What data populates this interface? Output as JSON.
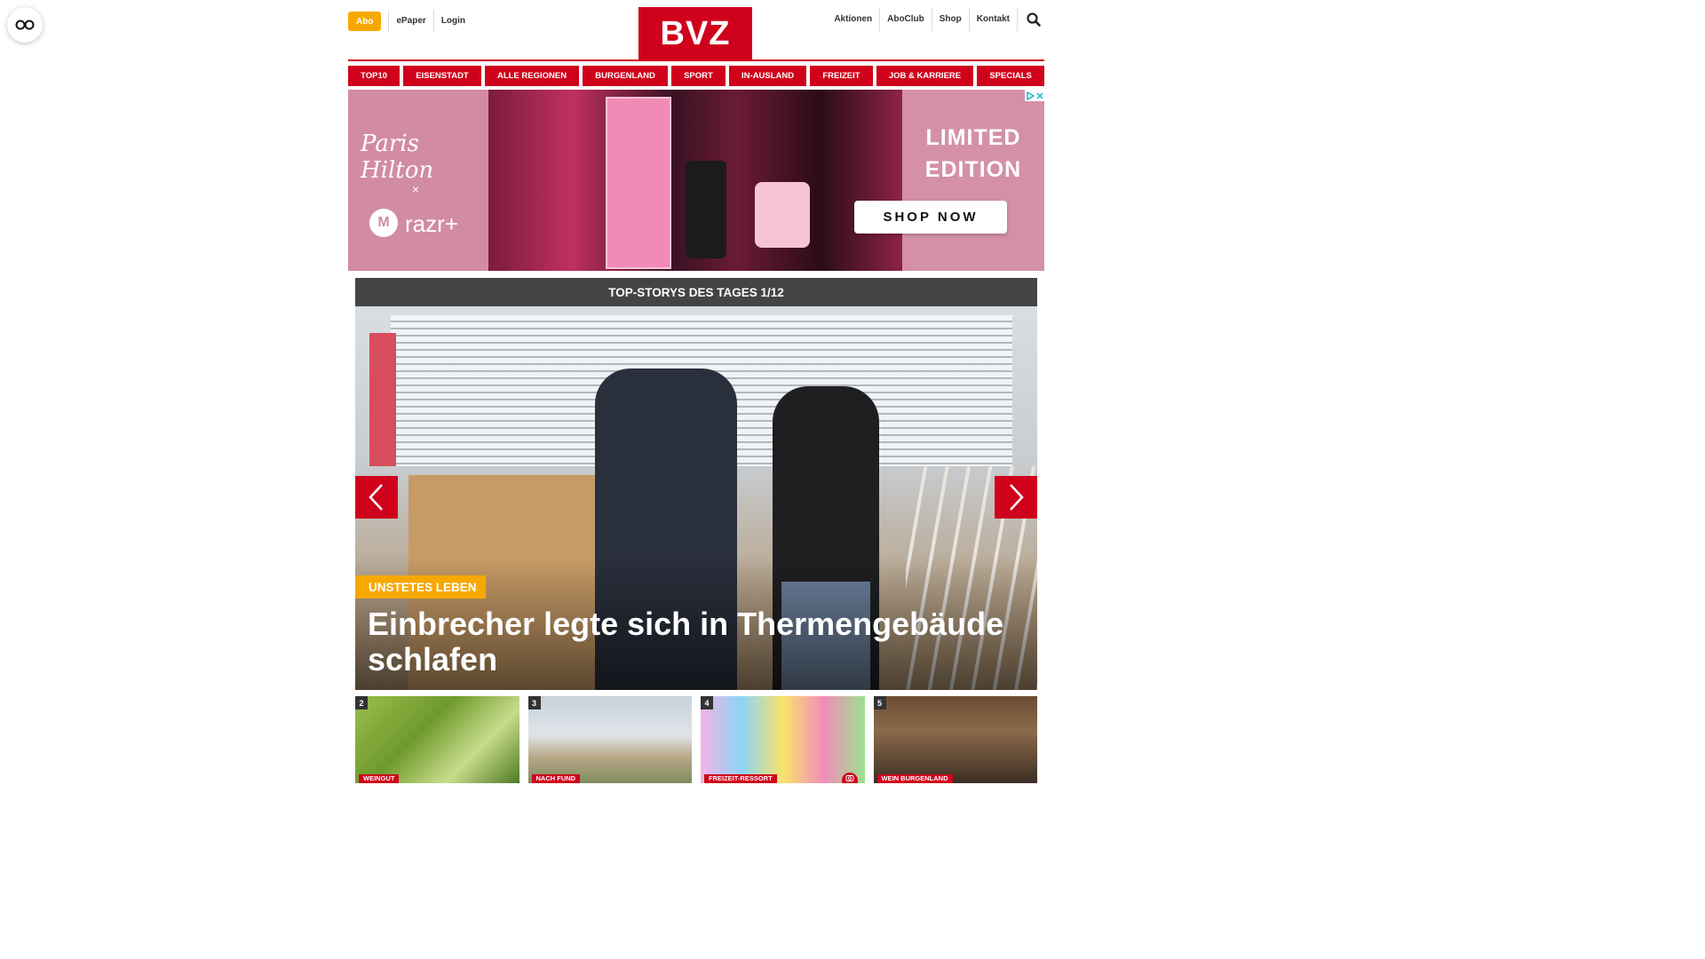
{
  "header": {
    "abo": "Abo",
    "epaper": "ePaper",
    "login": "Login",
    "logo": "BVZ",
    "right_links": [
      "Aktionen",
      "AboClub",
      "Shop",
      "Kontakt"
    ]
  },
  "nav": {
    "items": [
      "TOP10",
      "EISENSTADT",
      "ALLE REGIONEN",
      "BURGENLAND",
      "SPORT",
      "IN-AUSLAND",
      "FREIZEIT",
      "JOB & KARRIERE",
      "SPECIALS"
    ]
  },
  "ad": {
    "brand_script": "Paris Hilton",
    "x": "×",
    "moto_letter": "M",
    "razr": "razr+",
    "headline_line1": "LIMITED",
    "headline_line2": "EDITION",
    "cta": "SHOP NOW"
  },
  "stories": {
    "heading": "TOP-STORYS DES TAGES 1/12",
    "current": {
      "kicker": "UNSTETES LEBEN",
      "title": "Einbrecher legte sich in Thermengebäude schlafen"
    },
    "thumbs": [
      {
        "number": "2",
        "tag": "WEINGUT"
      },
      {
        "number": "3",
        "tag": "NACH FUND"
      },
      {
        "number": "4",
        "tag": "FREIZEIT-RESSORT"
      },
      {
        "number": "5",
        "tag": "WEIN BURGENLAND"
      }
    ]
  },
  "colors": {
    "brand_red": "#d0021b",
    "abo_orange": "#f7a800",
    "header_dark": "#444444"
  },
  "icons": {
    "accessibility": "glasses-icon",
    "search": "search-icon",
    "prev": "chevron-left-icon",
    "next": "chevron-right-icon",
    "camera": "camera-icon"
  }
}
